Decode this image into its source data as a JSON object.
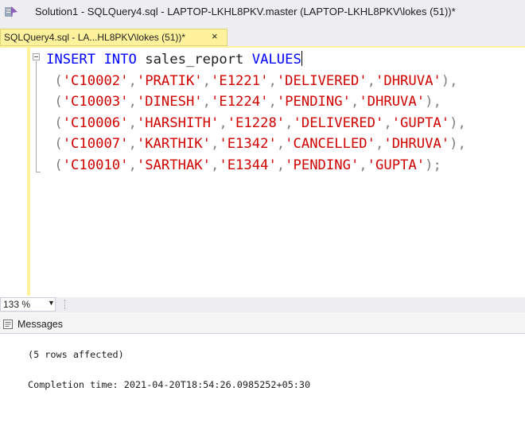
{
  "window": {
    "title": "Solution1 - SQLQuery4.sql - LAPTOP-LKHL8PKV.master (LAPTOP-LKHL8PKV\\lokes (51))*"
  },
  "tab": {
    "title": "SQLQuery4.sql - LA...HL8PKV\\lokes (51))*",
    "close": "×"
  },
  "editor": {
    "lines": [
      {
        "t": "kw",
        "v": "INSERT INTO"
      },
      {
        "t": "id",
        "v": "sales_report"
      },
      {
        "t": "kw",
        "v": "VALUES"
      }
    ],
    "keyword_insert": "INSERT",
    "keyword_into": "INTO",
    "table_name": "sales_report",
    "keyword_values": "VALUES",
    "rows": [
      [
        "'C10002'",
        "'PRATIK'",
        "'E1221'",
        "'DELIVERED'",
        "'DHRUVA'"
      ],
      [
        "'C10003'",
        "'DINESH'",
        "'E1224'",
        "'PENDING'",
        "'DHRUVA'"
      ],
      [
        "'C10006'",
        "'HARSHITH'",
        "'E1228'",
        "'DELIVERED'",
        "'GUPTA'"
      ],
      [
        "'C10007'",
        "'KARTHIK'",
        "'E1342'",
        "'CANCELLED'",
        "'DHRUVA'"
      ],
      [
        "'C10010'",
        "'SARTHAK'",
        "'E1344'",
        "'PENDING'",
        "'GUPTA'"
      ]
    ],
    "row_terminators": [
      ",",
      ",",
      ",",
      ",",
      ";"
    ]
  },
  "status": {
    "zoom": "133 %"
  },
  "results": {
    "tab_label": "Messages",
    "messages": [
      "(5 rows affected)",
      "Completion time: 2021-04-20T18:54:26.0985252+05:30"
    ]
  },
  "colors": {
    "keyword": "#0000ff",
    "string": "#d10000",
    "identifier": "#1e1e1e",
    "punctuation": "#808080",
    "tab_accent": "#fff29d"
  }
}
